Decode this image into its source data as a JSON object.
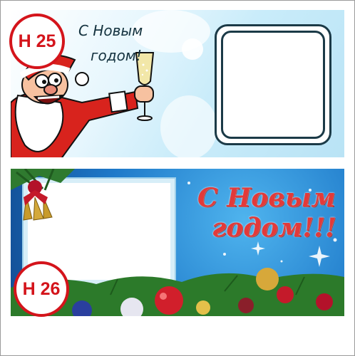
{
  "cards": [
    {
      "badge": "H 25",
      "greeting_line1": "С Новым",
      "greeting_line2": "годом!"
    },
    {
      "badge": "H 26",
      "greeting_line1": "С Новым",
      "greeting_line2": "годом!!!"
    }
  ],
  "colors": {
    "badge_red": "#d4141b",
    "greeting_red": "#e23a3a",
    "sky_blue": "#1e79c9",
    "ink": "#14323f"
  },
  "icons": [
    "santa-illustration",
    "champagne-glass-icon",
    "christmas-bells-icon",
    "ornament-icon",
    "sparkle-icon"
  ]
}
